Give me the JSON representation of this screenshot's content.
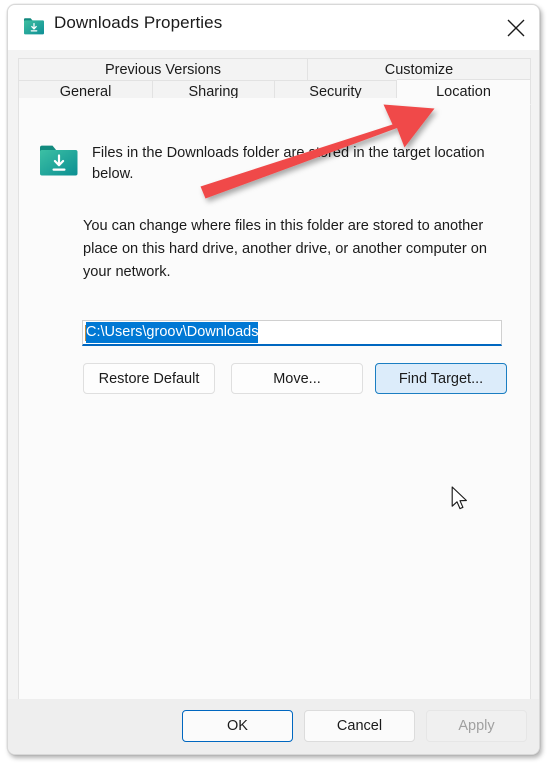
{
  "window": {
    "title": "Downloads Properties",
    "icon": "downloads-folder-icon",
    "close_icon": "close-icon"
  },
  "tabs": {
    "row1": [
      {
        "label": "Previous Versions",
        "active": false
      },
      {
        "label": "Customize",
        "active": false
      }
    ],
    "row2": [
      {
        "label": "General",
        "active": false
      },
      {
        "label": "Sharing",
        "active": false
      },
      {
        "label": "Security",
        "active": false
      },
      {
        "label": "Location",
        "active": true
      }
    ]
  },
  "content": {
    "folder_icon": "downloads-folder-icon",
    "intro_text": "Files in the Downloads folder are stored in the target location below.",
    "body_text": "You can change where files in this folder are stored to another place on this hard drive, another drive, or another computer on your network.",
    "path_field": {
      "value": "C:\\Users\\groov\\Downloads",
      "selected": true
    },
    "buttons": {
      "restore_default": "Restore Default",
      "move": "Move...",
      "find_target": "Find Target..."
    }
  },
  "footer": {
    "ok": "OK",
    "cancel": "Cancel",
    "apply": "Apply",
    "apply_disabled": true
  },
  "annotation": {
    "type": "red-arrow",
    "points_to": "Location",
    "color": "#f04a4a"
  },
  "colors": {
    "accent": "#0078d4",
    "focus_border": "#0067c0",
    "selection": "#0078d4",
    "folder_icon": "#17a08a",
    "annotation_red": "#f04a4a",
    "window_bg": "#f3f3f3",
    "content_bg": "#fbfbfb",
    "footer_bg": "#eeeeee"
  }
}
